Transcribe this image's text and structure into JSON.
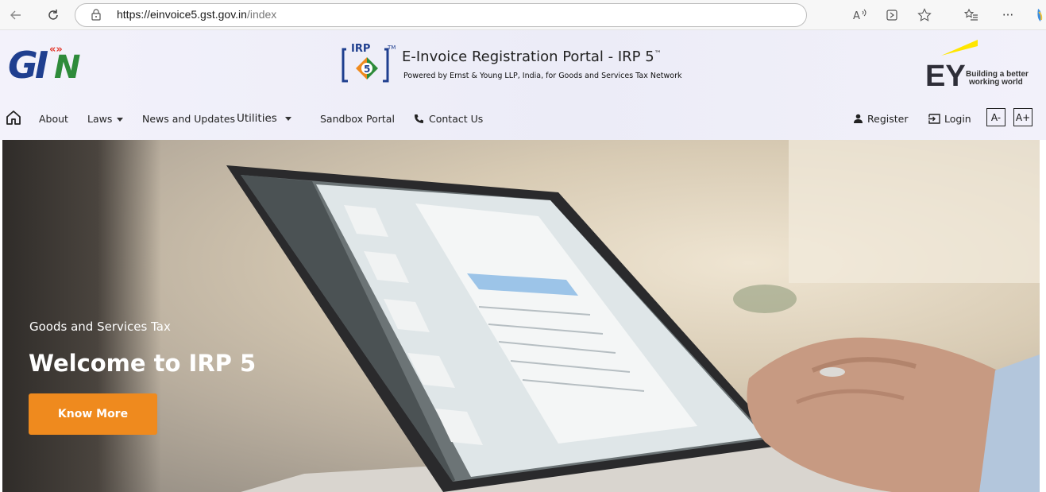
{
  "browser": {
    "url_host": "https://einvoice5.gst.gov.in",
    "url_path": "/index",
    "icons": [
      "back-icon",
      "refresh-icon",
      "lock-icon",
      "read-aloud-icon",
      "app-available-icon",
      "favorite-icon",
      "favorites-bar-icon",
      "more-icon"
    ],
    "more_label": "···"
  },
  "header": {
    "gstn_logo_text": "GSTN",
    "irp_logo_text": "IRP",
    "irp_logo_number": "5",
    "title": "E-Invoice Registration Portal - IRP 5",
    "title_tm": "™",
    "subtitle": "Powered by Ernst & Young LLP, India, for Goods and Services Tax Network",
    "ey_logo_text": "EY",
    "ey_tagline_line1": "Building a better",
    "ey_tagline_line2": "working world"
  },
  "nav": {
    "items": [
      {
        "label": "About"
      },
      {
        "label": "Laws"
      },
      {
        "label": "News and Updates"
      },
      {
        "label": "Utilities"
      },
      {
        "label": "Sandbox Portal"
      },
      {
        "label": "Contact Us"
      }
    ],
    "register": "Register",
    "login": "Login",
    "font_decrease": "A-",
    "font_increase": "A+"
  },
  "hero": {
    "subtitle": "Goods and Services Tax",
    "title": "Welcome to IRP 5",
    "button": "Know More"
  },
  "colors": {
    "accent_orange": "#ef8a1e",
    "gstn_blue": "#1f3f8f",
    "gstn_green": "#2e8b3a",
    "ey_yellow": "#ffe600"
  }
}
